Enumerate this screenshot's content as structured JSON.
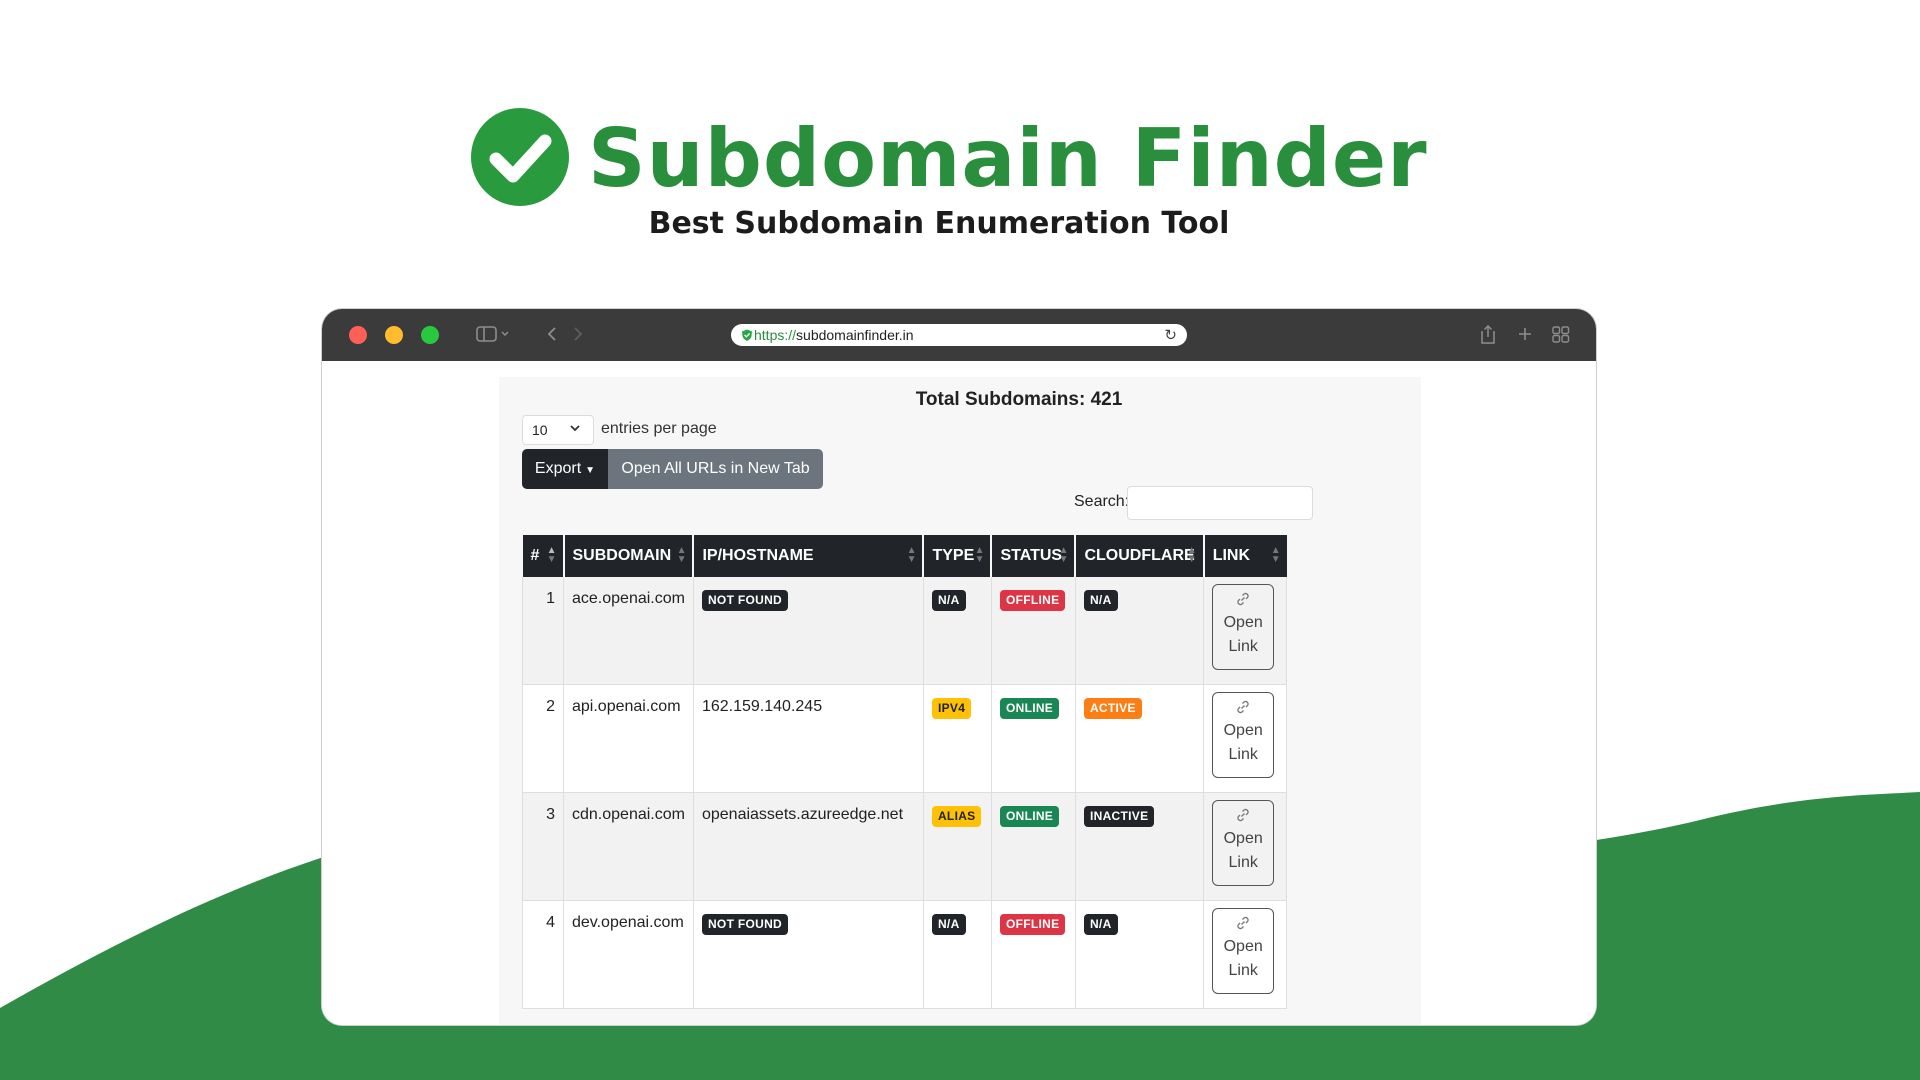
{
  "hero": {
    "brand": "Subdomain Finder",
    "tagline": "Best Subdomain Enumeration Tool"
  },
  "browser": {
    "url_protocol": "https://",
    "url_host": "subdomainfinder.in"
  },
  "page": {
    "total": "Total Subdomains: 421",
    "entries_select": "10",
    "entries_label": "entries per page",
    "export_label": "Export",
    "open_all_label": "Open All URLs in New Tab",
    "search_label": "Search:",
    "search_value": ""
  },
  "table": {
    "headers": [
      "#",
      "SUBDOMAIN",
      "IP/HOSTNAME",
      "TYPE",
      "STATUS",
      "CLOUDFLARE",
      "LINK"
    ],
    "rows": [
      {
        "n": "1",
        "subdomain": "ace.openai.com",
        "ip": "NOT FOUND",
        "ip_badge": true,
        "type": "N/A",
        "type_color": "dark",
        "status": "OFFLINE",
        "status_color": "red",
        "cloudflare": "N/A",
        "cf_color": "dark",
        "link_line1": "Open",
        "link_line2": "Link"
      },
      {
        "n": "2",
        "subdomain": "api.openai.com",
        "ip": "162.159.140.245",
        "ip_badge": false,
        "type": "IPV4",
        "type_color": "yellow",
        "status": "ONLINE",
        "status_color": "green",
        "cloudflare": "ACTIVE",
        "cf_color": "orange",
        "link_line1": "Open",
        "link_line2": "Link"
      },
      {
        "n": "3",
        "subdomain": "cdn.openai.com",
        "ip": "openaiassets.azureedge.net",
        "ip_badge": false,
        "type": "ALIAS",
        "type_color": "yellow",
        "status": "ONLINE",
        "status_color": "green",
        "cloudflare": "INACTIVE",
        "cf_color": "dark",
        "link_line1": "Open",
        "link_line2": "Link"
      },
      {
        "n": "4",
        "subdomain": "dev.openai.com",
        "ip": "NOT FOUND",
        "ip_badge": true,
        "type": "N/A",
        "type_color": "dark",
        "status": "OFFLINE",
        "status_color": "red",
        "cloudflare": "N/A",
        "cf_color": "dark",
        "link_line1": "Open",
        "link_line2": "Link"
      }
    ]
  },
  "colors": {
    "brand_green": "#2a8f3d",
    "wave_green": "#2f8b45",
    "titlebar": "#3b3b3c"
  },
  "icons": {
    "logo": "check-circle-icon",
    "link": "link-icon"
  }
}
